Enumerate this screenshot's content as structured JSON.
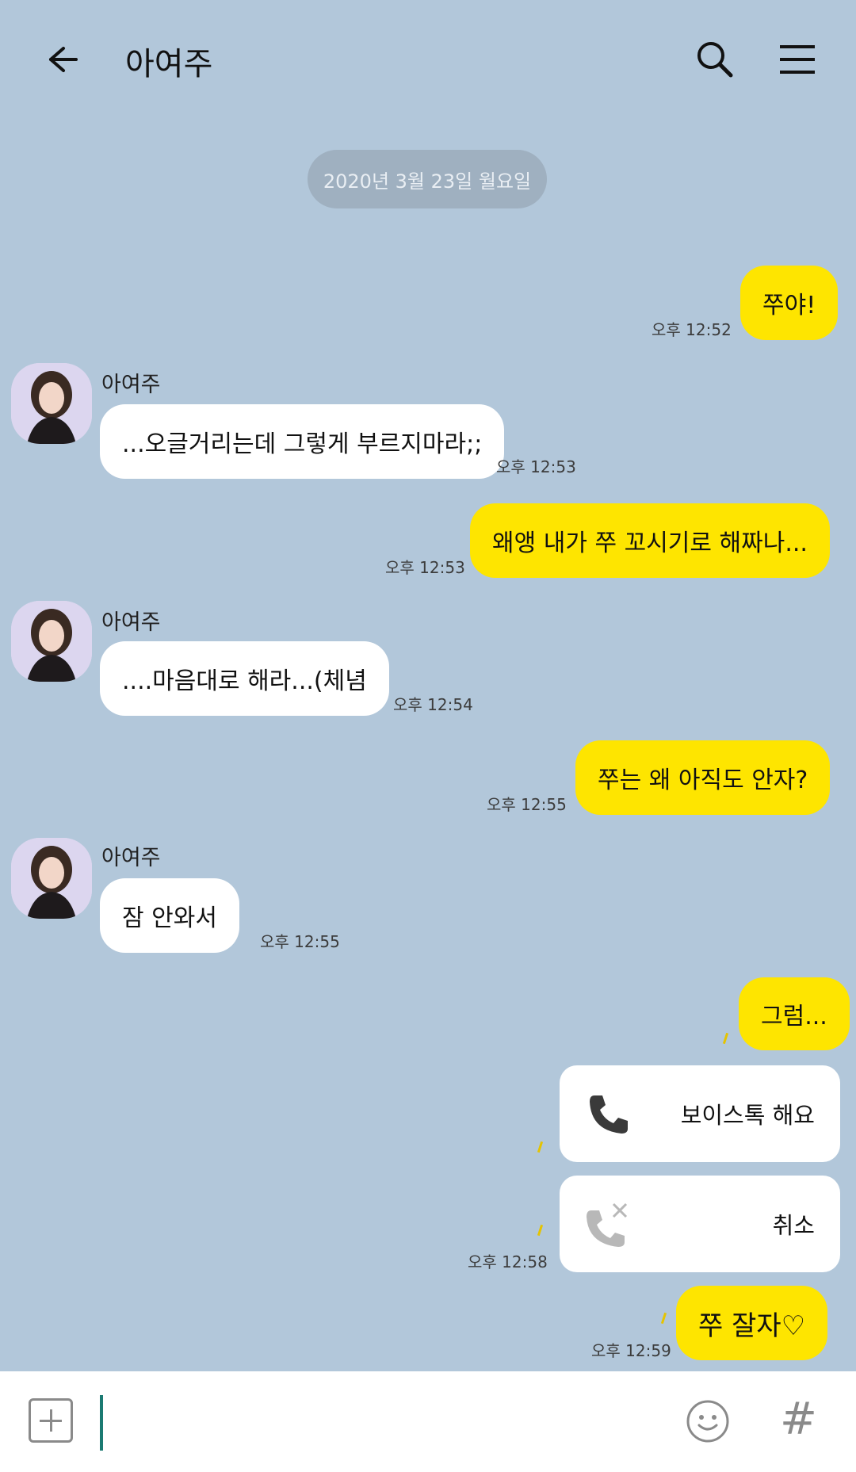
{
  "header": {
    "title": "아여주"
  },
  "date_divider": "2020년 3월 23일 월요일",
  "messages": [
    {
      "text": "쭈야!",
      "time": "오후 12:52"
    },
    {
      "sender": "아여주",
      "text": "...오글거리는데 그렇게 부르지마라;;",
      "time": "오후 12:53"
    },
    {
      "text": "왜앵 내가 쭈 꼬시기로 해짜나...",
      "time": "오후 12:53"
    },
    {
      "sender": "아여주",
      "text": "....마음대로 해라...(체념",
      "time": "오후 12:54"
    },
    {
      "text": "쭈는 왜 아직도 안자?",
      "time": "오후 12:55"
    },
    {
      "sender": "아여주",
      "text": "잠 안와서",
      "time": "오후 12:55"
    },
    {
      "text": "그럼..."
    },
    {
      "text": "쭈 잘자♡",
      "time": "오후 12:59"
    }
  ],
  "voice_card": {
    "label": "보이스톡 해요",
    "icon": "phone-icon"
  },
  "cancel_card": {
    "label": "취소",
    "icon": "phone-cancel-icon",
    "time": "오후 12:58"
  },
  "colors": {
    "background": "#b2c7da",
    "my_bubble": "#fee500",
    "their_bubble": "#ffffff",
    "caret": "#1b7a72"
  }
}
